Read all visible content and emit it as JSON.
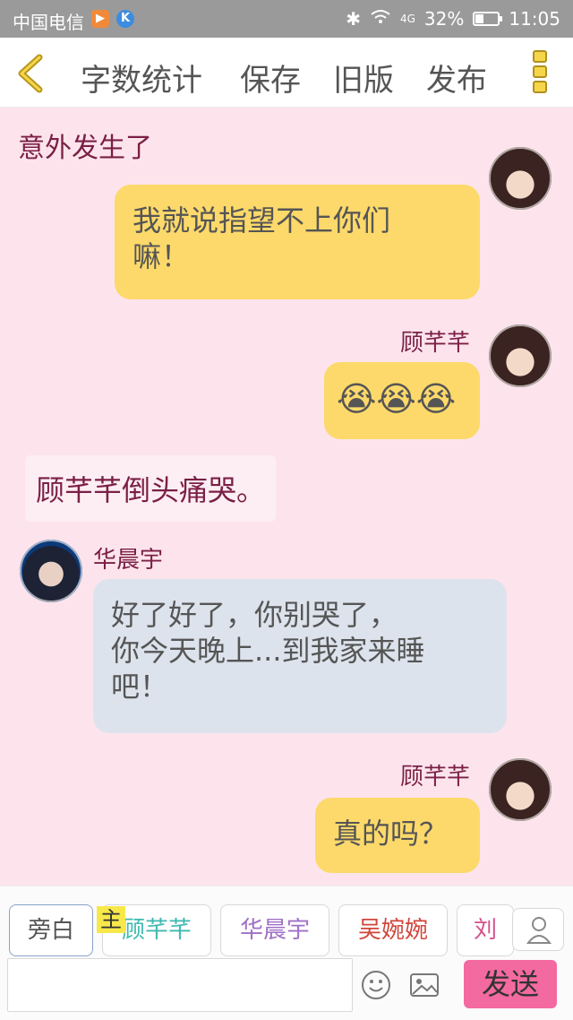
{
  "status_bar": {
    "carrier": "中国电信",
    "battery": "32%",
    "battery_level": 0.32,
    "network": "4G",
    "time": "11:05"
  },
  "toolbar": {
    "word_count": "字数统计",
    "save": "保存",
    "old_version": "旧版",
    "publish": "发布"
  },
  "chat": {
    "heading": "意外发生了",
    "messages": [
      {
        "side": "right",
        "speaker": "",
        "text_lines": [
          "我就说指望不上你们",
          "嘛！"
        ],
        "avatar": "girl"
      },
      {
        "side": "right",
        "speaker": "顾芊芊",
        "text": "😭😭😭",
        "avatar": "girl"
      },
      {
        "type": "narration",
        "text": "顾芊芊倒头痛哭。"
      },
      {
        "side": "left",
        "speaker": "华晨宇",
        "text_lines": [
          "好了好了，你别哭了，",
          "你今天晚上...到我家来睡",
          "吧！"
        ],
        "avatar": "boy"
      },
      {
        "side": "right",
        "speaker": "顾芊芊",
        "text": "真的吗？",
        "avatar": "girl"
      }
    ]
  },
  "bottom": {
    "roles": [
      {
        "label": "旁白",
        "color": "#555555"
      },
      {
        "label": "顾芊芊",
        "color": "#3fb8b0"
      },
      {
        "label": "华晨宇",
        "color": "#a070c8"
      },
      {
        "label": "吴婉婉",
        "color": "#d0463c"
      },
      {
        "label": "刘露",
        "color": "#d4508c"
      }
    ],
    "main_tag": "主",
    "input_value": "",
    "send": "发送"
  }
}
